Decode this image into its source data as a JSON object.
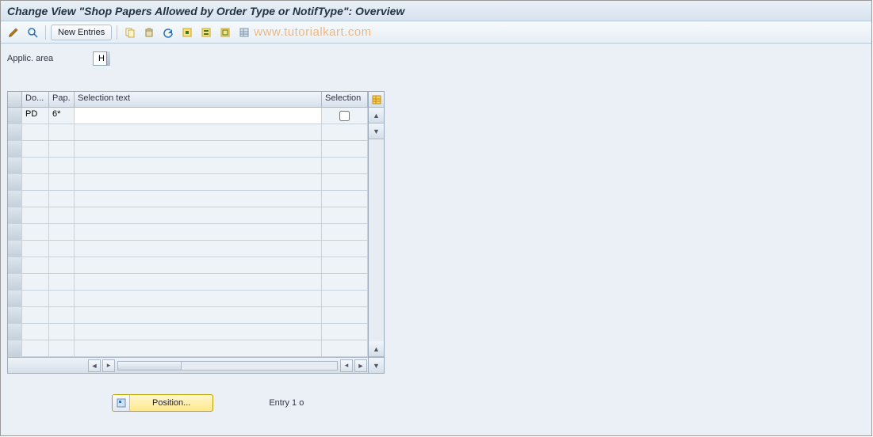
{
  "title": "Change View \"Shop Papers Allowed by Order Type or NotifType\": Overview",
  "toolbar": {
    "new_entries_label": "New Entries"
  },
  "watermark": "www.tutorialkart.com",
  "form": {
    "applic_area_label": "Applic. area",
    "applic_area_value": "H"
  },
  "table": {
    "headers": {
      "do": "Do...",
      "pap": "Pap.",
      "selection_text": "Selection text",
      "selection": "Selection"
    },
    "rows": [
      {
        "do": "PD",
        "pap": "6*",
        "selection_text": "",
        "selection_checked": false
      }
    ],
    "empty_row_count": 14
  },
  "footer": {
    "position_label": "Position...",
    "entry_text": "Entry 1 o"
  }
}
